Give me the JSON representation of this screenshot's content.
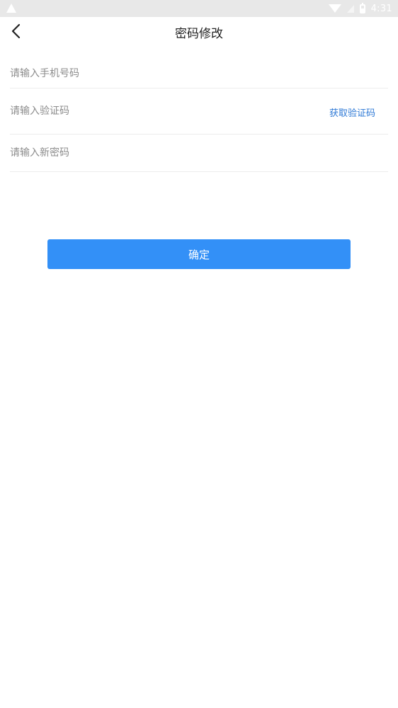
{
  "status_bar": {
    "time": "4:31"
  },
  "header": {
    "title": "密码修改"
  },
  "form": {
    "phone_placeholder": "请输入手机号码",
    "code_placeholder": "请输入验证码",
    "get_code_label": "获取验证码",
    "new_password_placeholder": "请输入新密码",
    "confirm_label": "确定"
  },
  "colors": {
    "accent": "#3390f7",
    "link": "#2f7ad6",
    "status_bar": "#e8e8e8"
  }
}
